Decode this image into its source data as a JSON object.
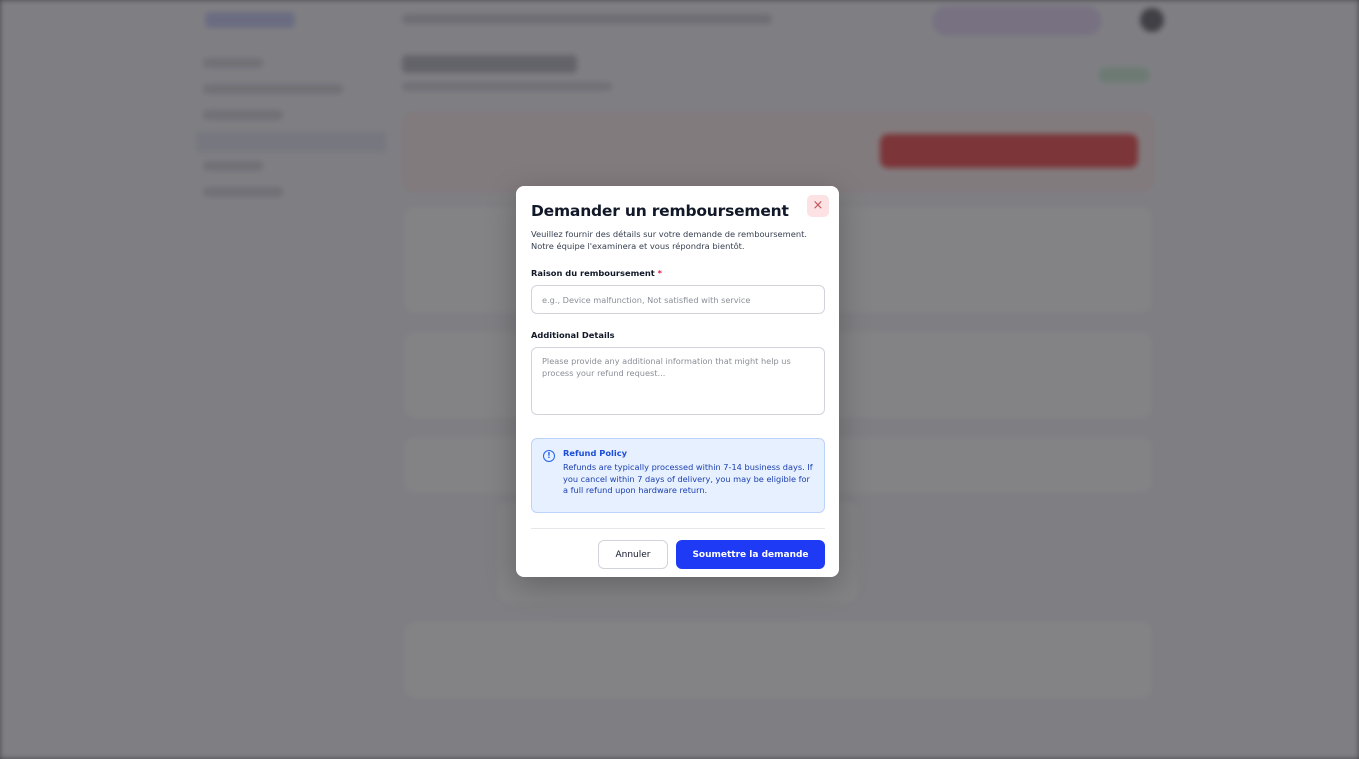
{
  "modal": {
    "title": "Demander un remboursement",
    "description": "Veuillez fournir des détails sur votre demande de remboursement. Notre équipe l'examinera et vous répondra bientôt.",
    "close_symbol": "×",
    "reason": {
      "label": "Raison du remboursement",
      "required_mark": "*",
      "placeholder": "e.g., Device malfunction, Not satisfied with service",
      "value": ""
    },
    "details": {
      "label": "Additional Details",
      "placeholder": "Please provide any additional information that might help us process your refund request...",
      "value": ""
    },
    "policy": {
      "icon": "info-icon",
      "icon_glyph": "!",
      "title": "Refund Policy",
      "text": "Refunds are typically processed within 7-14 business days. If you cancel within 7 days of delivery, you may be eligible for a full refund upon hardware return."
    },
    "cancel_label": "Annuler",
    "submit_label": "Soumettre la demande"
  },
  "colors": {
    "primary": "#1e3af5",
    "danger": "#e11d48",
    "info_bg": "#e6f0ff",
    "info_text": "#1e40af"
  }
}
